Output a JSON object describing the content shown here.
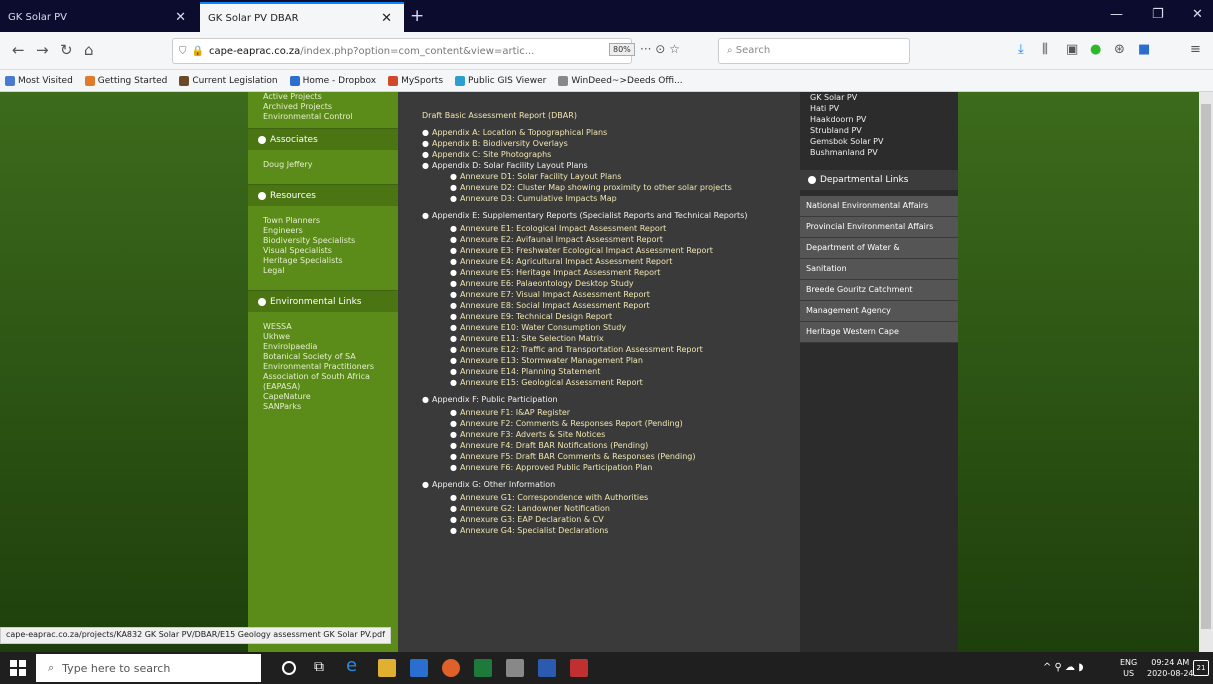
{
  "browser": {
    "tabs": [
      {
        "title": "GK Solar PV"
      },
      {
        "title": "GK Solar PV DBAR"
      }
    ],
    "url_host": "cape-eaprac.co.za",
    "url_path": "/index.php?option=com_content&view=artic...",
    "zoom": "80%",
    "search_placeholder": "Search",
    "bookmarks": [
      {
        "label": "Most Visited",
        "color": "#4a7bd0"
      },
      {
        "label": "Getting Started",
        "color": "#e07b2a"
      },
      {
        "label": "Current Legislation",
        "color": "#6b4a2a"
      },
      {
        "label": "Home - Dropbox",
        "color": "#2a6fd0"
      },
      {
        "label": "MySports",
        "color": "#d04a2a"
      },
      {
        "label": "Public GIS Viewer",
        "color": "#2a9fd0"
      },
      {
        "label": "WinDeed~>Deeds Offi...",
        "color": "#888888"
      }
    ]
  },
  "left_menu": {
    "top_links": [
      "Active Projects",
      "Archived Projects",
      "Environmental Control"
    ],
    "sections": [
      {
        "title": "Associates",
        "links": [
          "Doug Jeffery"
        ]
      },
      {
        "title": "Resources",
        "links": [
          "Town Planners",
          "Engineers",
          "Biodiversity Specialists",
          "Visual Specialists",
          "Heritage Specialists",
          "Legal"
        ]
      },
      {
        "title": "Environmental Links",
        "links": [
          "WESSA",
          "Ukhwe",
          "Envirolpaedia",
          "Botanical Society of SA",
          "Environmental Practitioners",
          "Association of South Africa",
          "(EAPASA)",
          "CapeNature",
          "SANParks"
        ]
      }
    ]
  },
  "content": {
    "title": "Draft Basic Assessment Report (DBAR)",
    "items": [
      {
        "level": 1,
        "text": "Appendix A: Location & Topographical Plans"
      },
      {
        "level": 1,
        "text": "Appendix B: Biodiversity Overlays"
      },
      {
        "level": 1,
        "text": "Appendix C: Site Photographs"
      },
      {
        "level": 1,
        "text": "Appendix D: Solar Facility Layout Plans"
      },
      {
        "level": 2,
        "text": "Annexure D1: Solar Facility Layout Plans"
      },
      {
        "level": 2,
        "text": "Annexure D2: Cluster Map showing proximity to other solar projects"
      },
      {
        "level": 2,
        "text": "Annexure D3: Cumulative Impacts Map"
      },
      {
        "level": 1,
        "text": "Appendix E: Supplementary Reports (Specialist Reports and Technical Reports)"
      },
      {
        "level": 2,
        "text": "Annexure E1: Ecological Impact Assessment Report"
      },
      {
        "level": 2,
        "text": "Annexure E2: Avifaunal Impact Assessment Report"
      },
      {
        "level": 2,
        "text": "Annexure E3: Freshwater Ecological Impact Assessment Report"
      },
      {
        "level": 2,
        "text": "Annexure E4: Agricultural Impact Assessment Report"
      },
      {
        "level": 2,
        "text": "Annexure E5: Heritage Impact Assessment Report"
      },
      {
        "level": 2,
        "text": "Annexure E6: Palaeontology Desktop Study"
      },
      {
        "level": 2,
        "text": "Annexure E7: Visual Impact Assessment Report"
      },
      {
        "level": 2,
        "text": "Annexure E8: Social Impact Assessment Report"
      },
      {
        "level": 2,
        "text": "Annexure E9: Technical Design Report"
      },
      {
        "level": 2,
        "text": "Annexure E10: Water Consumption Study"
      },
      {
        "level": 2,
        "text": "Annexure E11: Site Selection Matrix"
      },
      {
        "level": 2,
        "text": "Annexure E12: Traffic and Transportation Assessment Report"
      },
      {
        "level": 2,
        "text": "Annexure E13: Stormwater Management Plan"
      },
      {
        "level": 2,
        "text": "Annexure E14: Planning Statement"
      },
      {
        "level": 2,
        "text": "Annexure E15: Geological Assessment Report"
      },
      {
        "level": 1,
        "text": "Appendix F: Public Participation"
      },
      {
        "level": 2,
        "text": "Annexure F1: I&AP Register"
      },
      {
        "level": 2,
        "text": "Annexure F2: Comments & Responses Report (Pending)"
      },
      {
        "level": 2,
        "text": "Annexure F3: Adverts & Site Notices"
      },
      {
        "level": 2,
        "text": "Annexure F4: Draft BAR Notifications (Pending)"
      },
      {
        "level": 2,
        "text": "Annexure F5: Draft BAR Comments & Responses (Pending)"
      },
      {
        "level": 2,
        "text": "Annexure F6: Approved Public Participation Plan"
      },
      {
        "level": 1,
        "text": "Appendix G: Other Information"
      },
      {
        "level": 2,
        "text": "Annexure G1: Correspondence with Authorities"
      },
      {
        "level": 2,
        "text": "Annexure G2: Landowner Notification"
      },
      {
        "level": 2,
        "text": "Annexure G3: EAP Declaration & CV"
      },
      {
        "level": 2,
        "text": "Annexure G4: Specialist Declarations"
      }
    ]
  },
  "right_menu": {
    "project_links": [
      "GK Solar PV",
      "Hati PV",
      "Haakdoorn PV",
      "Strubland PV",
      "Gemsbok Solar PV",
      "Bushmanland PV"
    ],
    "dept_title": "Departmental Links",
    "dept_links": [
      "National Environmental Affairs",
      "Provincial Environmental Affairs",
      "Department of Water &",
      "Sanitation",
      "Breede Gouritz Catchment",
      "Management Agency",
      "Heritage Western Cape"
    ]
  },
  "status_url": "cape-eaprac.co.za/projects/KA832 GK Solar PV/DBAR/E15 Geology assessment GK Solar PV.pdf",
  "taskbar": {
    "search_placeholder": "Type here to search",
    "lang_top": "ENG",
    "lang_bottom": "US",
    "time": "09:24 AM",
    "date": "2020-08-24",
    "notifications": "21"
  }
}
